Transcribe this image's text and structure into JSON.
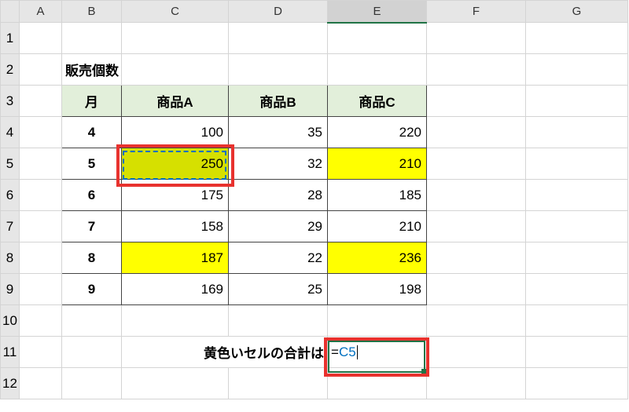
{
  "columns": [
    "A",
    "B",
    "C",
    "D",
    "E",
    "F",
    "G"
  ],
  "rows": [
    "1",
    "2",
    "3",
    "4",
    "5",
    "6",
    "7",
    "8",
    "9",
    "10",
    "11",
    "12"
  ],
  "selected_column": "E",
  "title": "販売個数",
  "table": {
    "headers": {
      "month": "月",
      "a": "商品A",
      "b": "商品B",
      "c": "商品C"
    },
    "rows": [
      {
        "m": "4",
        "a": "100",
        "b": "35",
        "c": "220"
      },
      {
        "m": "5",
        "a": "250",
        "b": "32",
        "c": "210"
      },
      {
        "m": "6",
        "a": "175",
        "b": "28",
        "c": "185"
      },
      {
        "m": "7",
        "a": "158",
        "b": "29",
        "c": "210"
      },
      {
        "m": "8",
        "a": "187",
        "b": "22",
        "c": "236"
      },
      {
        "m": "9",
        "a": "169",
        "b": "25",
        "c": "198"
      }
    ]
  },
  "label": "黄色いセルの合計は",
  "formula": {
    "eq": "=",
    "ref": "C5"
  },
  "chart_data": {
    "type": "table",
    "title": "販売個数",
    "columns": [
      "月",
      "商品A",
      "商品B",
      "商品C"
    ],
    "rows": [
      [
        4,
        100,
        35,
        220
      ],
      [
        5,
        250,
        32,
        210
      ],
      [
        6,
        175,
        28,
        185
      ],
      [
        7,
        158,
        29,
        210
      ],
      [
        8,
        187,
        22,
        236
      ],
      [
        9,
        169,
        25,
        198
      ]
    ],
    "highlighted_yellow_cells": [
      "C5",
      "E5",
      "C8",
      "E8"
    ],
    "formula_cell": "E11",
    "formula_text": "=C5",
    "copied_range": "C5"
  }
}
